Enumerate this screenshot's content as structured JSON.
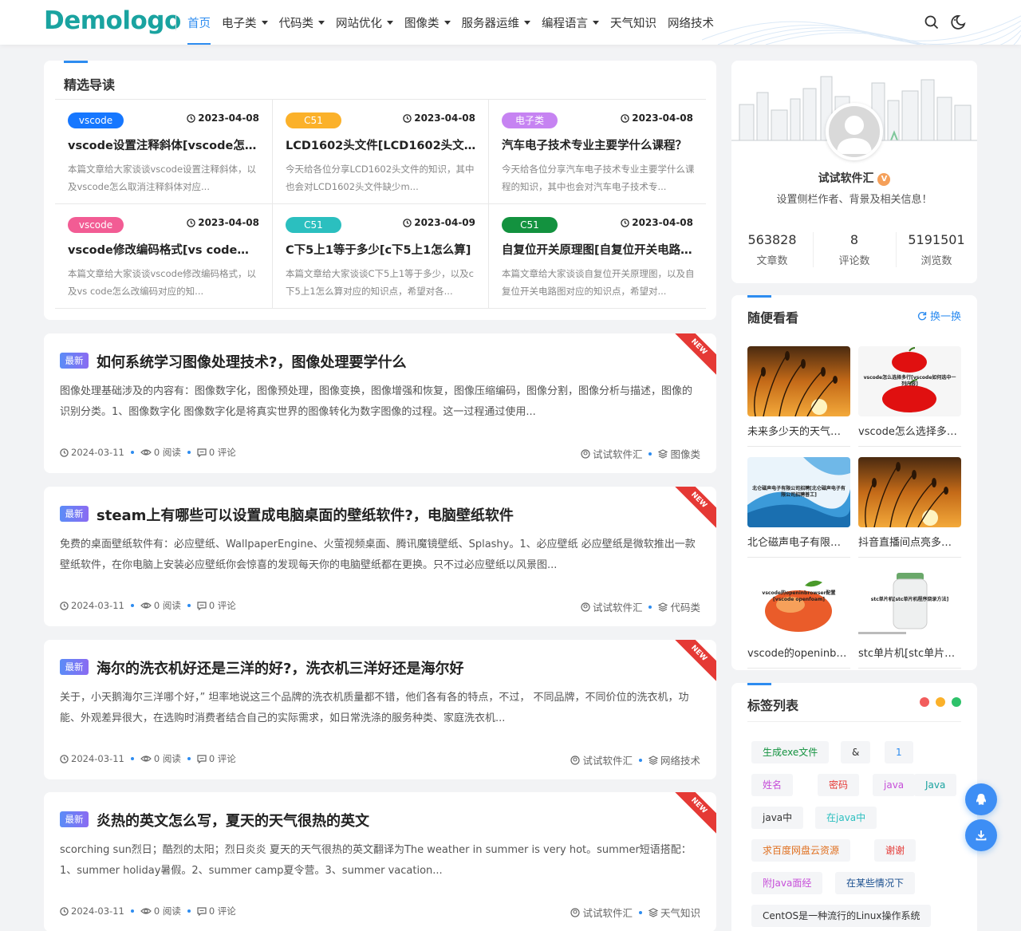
{
  "header": {
    "logo": "Demologo",
    "nav": [
      {
        "label": "首页",
        "active": true,
        "caret": false
      },
      {
        "label": "电子类",
        "caret": true
      },
      {
        "label": "代码类",
        "caret": true
      },
      {
        "label": "网站优化",
        "caret": true
      },
      {
        "label": "图像类",
        "caret": true
      },
      {
        "label": "服务器运维",
        "caret": true
      },
      {
        "label": "编程语言",
        "caret": true
      },
      {
        "label": "天气知识",
        "caret": false
      },
      {
        "label": "网络技术",
        "caret": false
      }
    ]
  },
  "featured": {
    "title": "精选导读",
    "items": [
      {
        "badge": "vscode",
        "badge_color": "#1677ff",
        "date": "2023-04-08",
        "title": "vscode设置注释斜体[vscode怎么取消注释斜体]",
        "desc": "本篇文章给大家谈谈vscode设置注释斜体，以及vscode怎么取消注释斜体对应..."
      },
      {
        "badge": "C51",
        "badge_color": "#fbb12a",
        "date": "2023-04-08",
        "title": "LCD1602头文件[LCD1602头文件缺少]",
        "desc": "今天给各位分享LCD1602头文件的知识，其中也会对LCD1602头文件缺少m..."
      },
      {
        "badge": "电子类",
        "badge_color": "#c683f2",
        "date": "2023-04-08",
        "title": "汽车电子技术专业主要学什么课程？",
        "desc": "今天给各位分享汽车电子技术专业主要学什么课程的知识，其中也会对汽车电子技术专..."
      },
      {
        "badge": "vscode",
        "badge_color": "#f25c94",
        "date": "2023-04-08",
        "title": "vscode修改编码格式[vs code怎么改编码]",
        "desc": "本篇文章给大家谈谈vscode修改编码格式，以及vs code怎么改编码对应的知..."
      },
      {
        "badge": "C51",
        "badge_color": "#2bbfbf",
        "date": "2023-04-09",
        "title": "C下5上1等于多少[c下5上1怎么算]",
        "desc": "本篇文章给大家谈谈C下5上1等于多少，以及c下5上1怎么算对应的知识点，希望对各..."
      },
      {
        "badge": "C51",
        "badge_color": "#13923f",
        "date": "2023-04-08",
        "title": "自复位开关原理图[自复位开关电路图]",
        "desc": "本篇文章给大家谈谈自复位开关原理图，以及自复位开关电路图对应的知识点，希望对..."
      }
    ]
  },
  "posts": [
    {
      "tag": "最新",
      "ribbon": "NEW",
      "title": "如何系统学习图像处理技术?，图像处理要学什么",
      "desc": "图像处理基础涉及的内容有：图像数字化，图像预处理，图像变换，图像增强和恢复，图像压缩编码，图像分割，图像分析与描述，图像的识别分类。1、图像数字化 图像数字化是将真实世界的图像转化为数字图像的过程。这一过程通过使用...",
      "date": "2024-03-11",
      "views": "0 阅读",
      "comments": "0 评论",
      "author": "试试软件汇",
      "category": "图像类"
    },
    {
      "tag": "最新",
      "ribbon": "NEW",
      "title": "steam上有哪些可以设置成电脑桌面的壁纸软件?，电脑壁纸软件",
      "desc": "免费的桌面壁纸软件有：必应壁纸、WallpaperEngine、火萤视频桌面、腾讯魔镜壁纸、Splashy。1、必应壁纸 必应壁纸是微软推出一款壁纸软件，在你电脑上安装必应壁纸你会惊喜的发现每天你的电脑壁纸都在更换。只不过必应壁纸以风景图...",
      "date": "2024-03-11",
      "views": "0 阅读",
      "comments": "0 评论",
      "author": "试试软件汇",
      "category": "代码类"
    },
    {
      "tag": "最新",
      "ribbon": "NEW",
      "title": "海尔的洗衣机好还是三洋的好?，洗衣机三洋好还是海尔好",
      "desc": "关于，小天鹅海尔三洋哪个好，” 坦率地说这三个品牌的洗衣机质量都不错，他们各有各的特点，不过， 不同品牌，不同价位的洗衣机，功能、外观差异很大，在选购时消费者结合自己的实际需求，如日常洗涤的服务种类、家庭洗衣机...",
      "date": "2024-03-11",
      "views": "0 阅读",
      "comments": "0 评论",
      "author": "试试软件汇",
      "category": "网络技术"
    },
    {
      "tag": "最新",
      "ribbon": "NEW",
      "title": "炎热的英文怎么写，夏天的天气很热的英文",
      "desc": "scorching sun烈日；酷烈的太阳；烈日炎炎 夏天的天气很热的英文翻译为The weather in summer is very hot。summer短语搭配：1、summer holiday暑假。2、summer camp夏令营。3、summer vacation...",
      "date": "2024-03-11",
      "views": "0 阅读",
      "comments": "0 评论",
      "author": "试试软件汇",
      "category": "天气知识"
    }
  ],
  "profile": {
    "name": "试试软件汇",
    "verified": "V",
    "desc": "设置侧栏作者、背景及相关信息！",
    "stats": [
      {
        "value": "563828",
        "label": "文章数"
      },
      {
        "value": "8",
        "label": "评论数"
      },
      {
        "value": "5191501",
        "label": "浏览数"
      }
    ]
  },
  "random": {
    "title": "随便看看",
    "refresh": "换一换",
    "items": [
      {
        "caption": "未来多少天的天气预报",
        "img": "sunset"
      },
      {
        "caption": "vscode怎么选择多行[vscode如何选中一列内容]",
        "img": "apple-doc",
        "img_text": "vscode怎么选择多行[vscode如何选中一列内容]"
      },
      {
        "caption": "北仑磁声电子有限公司招聘",
        "img": "blue-wave",
        "img_text": "北仑磁声电子有限公司招聘[北仑磁声电子有限公司招聘普工]"
      },
      {
        "caption": "抖音直播间点亮多少个粉丝灯牌",
        "img": "sunset"
      },
      {
        "caption": "vscode的openinbrowser配置",
        "img": "apple",
        "img_text": "vscode的openinbrowser配置[vscode openfoam]"
      },
      {
        "caption": "stc单片机[stc单片机程序烧录方法]",
        "img": "device",
        "img_text": "stc单片机[stc单片机程序烧录方法]"
      }
    ]
  },
  "tags": {
    "title": "标签列表",
    "lights": [
      "#f25c5c",
      "#fbb12a",
      "#2ec26a"
    ],
    "items": [
      {
        "label": "生成exe文件",
        "color": "#13923f"
      },
      {
        "label": "&",
        "color": "#333333"
      },
      {
        "label": "1",
        "color": "#2d8cf0"
      },
      {
        "label": "姓名",
        "color": "#c64fd9"
      },
      {
        "label": "密码",
        "color": "#e53935"
      },
      {
        "label": "java",
        "color": "#c64fd9"
      },
      {
        "label": "Java",
        "color": "#1aa3a0"
      },
      {
        "label": "java中",
        "color": "#333333"
      },
      {
        "label": "在java中",
        "color": "#2bbfbf"
      },
      {
        "label": "求百度网盘云资源",
        "color": "#e07020"
      },
      {
        "label": "谢谢",
        "color": "#e53935"
      },
      {
        "label": "附Java面经",
        "color": "#c64fd9"
      },
      {
        "label": "在某些情况下",
        "color": "#1a4f8f"
      },
      {
        "label": "CentOS是一种流行的Linux操作系统",
        "color": "#333333"
      }
    ]
  }
}
